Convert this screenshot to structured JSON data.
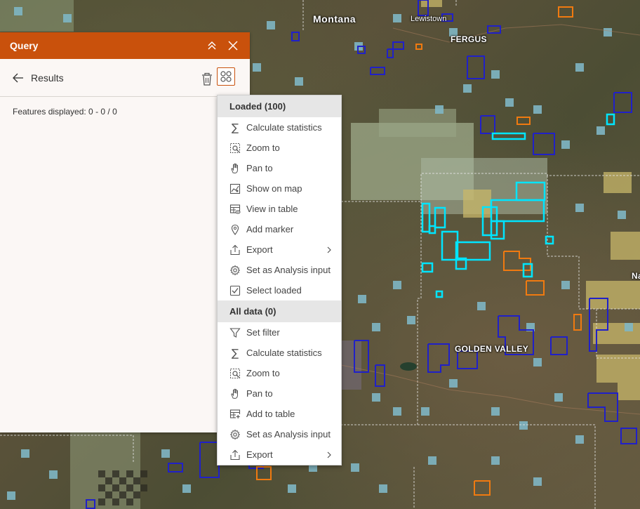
{
  "map": {
    "labels": {
      "state": "Montana",
      "city": "Lewistown",
      "county_1": "FERGUS",
      "county_2": "GOLDEN VALLEY",
      "edge": "Na"
    }
  },
  "panel": {
    "title": "Query",
    "results_label": "Results",
    "features_displayed": "Features displayed: 0 - 0 / 0"
  },
  "menu": {
    "loaded_header": "Loaded (100)",
    "loaded_items": [
      {
        "label": "Calculate statistics",
        "icon": "sigma-icon"
      },
      {
        "label": "Zoom to",
        "icon": "zoom-to-icon"
      },
      {
        "label": "Pan to",
        "icon": "hand-icon"
      },
      {
        "label": "Show on map",
        "icon": "map-icon"
      },
      {
        "label": "View in table",
        "icon": "table-view-icon"
      },
      {
        "label": "Add marker",
        "icon": "marker-icon"
      },
      {
        "label": "Export",
        "icon": "export-icon",
        "submenu": true
      },
      {
        "label": "Set as Analysis input",
        "icon": "gear-icon"
      },
      {
        "label": "Select loaded",
        "icon": "checkbox-icon"
      }
    ],
    "all_header": "All data (0)",
    "all_items": [
      {
        "label": "Set filter",
        "icon": "filter-icon"
      },
      {
        "label": "Calculate statistics",
        "icon": "sigma-icon"
      },
      {
        "label": "Zoom to",
        "icon": "zoom-to-icon"
      },
      {
        "label": "Pan to",
        "icon": "hand-icon"
      },
      {
        "label": "Add to table",
        "icon": "table-add-icon"
      },
      {
        "label": "Set as Analysis input",
        "icon": "gear-icon"
      },
      {
        "label": "Export",
        "icon": "export-icon",
        "submenu": true
      }
    ]
  },
  "colors": {
    "accent": "#c9510c",
    "highlight": "#00e5ff",
    "parcel_blue": "#2020c8",
    "parcel_orange": "#f07a10",
    "state_land": "#7fb6c4",
    "yellow_land": "#c8b76a"
  }
}
